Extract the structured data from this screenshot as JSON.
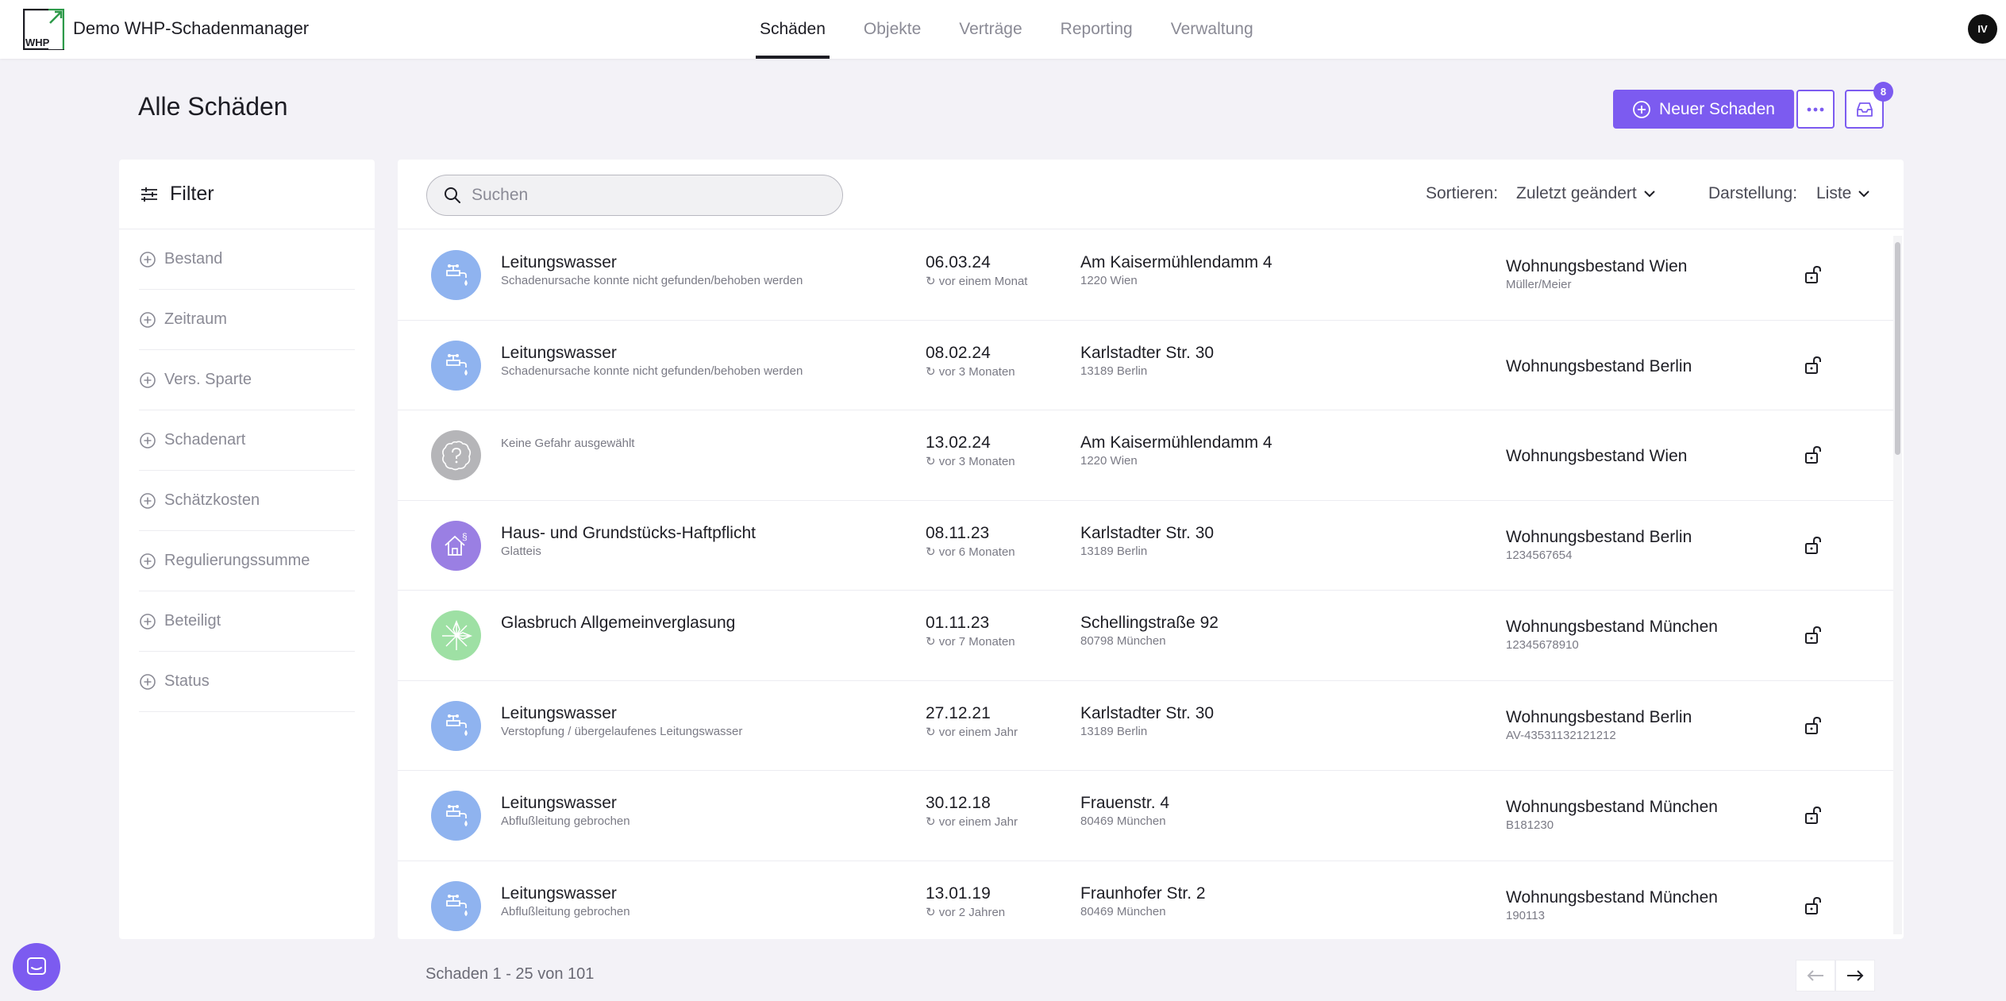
{
  "app": {
    "title": "Demo WHP-Schadenmanager",
    "logo_text": "WHP",
    "user_initials": "IV",
    "accent": "#7c5bf0"
  },
  "nav": [
    {
      "label": "Schäden",
      "active": true
    },
    {
      "label": "Objekte",
      "active": false
    },
    {
      "label": "Verträge",
      "active": false
    },
    {
      "label": "Reporting",
      "active": false
    },
    {
      "label": "Verwaltung",
      "active": false
    }
  ],
  "page": {
    "title": "Alle Schäden",
    "new_button": "Neuer Schaden",
    "inbox_count": "8"
  },
  "filter": {
    "title": "Filter",
    "items": [
      "Bestand",
      "Zeitraum",
      "Vers. Sparte",
      "Schadenart",
      "Schätzkosten",
      "Regulierungssumme",
      "Beteiligt",
      "Status"
    ]
  },
  "toolbar": {
    "search_placeholder": "Suchen",
    "sort_label": "Sortieren:",
    "sort_value": "Zuletzt geändert",
    "view_label": "Darstellung:",
    "view_value": "Liste"
  },
  "rows": [
    {
      "icon": "faucet-icon",
      "icon_color": "#8fb3ef",
      "title": "Leitungswasser",
      "subtitle": "Schadenursache konnte nicht gefunden/behoben werden",
      "date": "06.03.24",
      "relative": "vor einem Monat",
      "address": "Am Kaisermühlendamm 4",
      "city": "1220 Wien",
      "bestand": "Wohnungsbestand Wien",
      "ref": "Müller/Meier"
    },
    {
      "icon": "faucet-icon",
      "icon_color": "#8fb3ef",
      "title": "Leitungswasser",
      "subtitle": "Schadenursache konnte nicht gefunden/behoben werden",
      "date": "08.02.24",
      "relative": "vor 3 Monaten",
      "address": "Karlstadter Str. 30",
      "city": "13189 Berlin",
      "bestand": "Wohnungsbestand Berlin",
      "ref": ""
    },
    {
      "icon": "question-icon",
      "icon_color": "#b5b5b8",
      "title": "",
      "subtitle": "Keine Gefahr ausgewählt",
      "date": "13.02.24",
      "relative": "vor 3 Monaten",
      "address": "Am Kaisermühlendamm 4",
      "city": "1220 Wien",
      "bestand": "Wohnungsbestand Wien",
      "ref": ""
    },
    {
      "icon": "house-liability-icon",
      "icon_color": "#9a7fe3",
      "title": "Haus- und Grundstücks-Haftpflicht",
      "subtitle": "Glatteis",
      "date": "08.11.23",
      "relative": "vor 6 Monaten",
      "address": "Karlstadter Str. 30",
      "city": "13189 Berlin",
      "bestand": "Wohnungsbestand Berlin",
      "ref": "1234567654"
    },
    {
      "icon": "glass-break-icon",
      "icon_color": "#9ee0a4",
      "title": "Glasbruch Allgemeinverglasung",
      "subtitle": "",
      "date": "01.11.23",
      "relative": "vor 7 Monaten",
      "address": "Schellingstraße 92",
      "city": "80798 München",
      "bestand": "Wohnungsbestand München",
      "ref": "12345678910"
    },
    {
      "icon": "faucet-icon",
      "icon_color": "#8fb3ef",
      "title": "Leitungswasser",
      "subtitle": "Verstopfung / übergelaufenes Leitungswasser",
      "date": "27.12.21",
      "relative": "vor einem Jahr",
      "address": "Karlstadter Str. 30",
      "city": "13189 Berlin",
      "bestand": "Wohnungsbestand Berlin",
      "ref": "AV-43531132121212"
    },
    {
      "icon": "faucet-icon",
      "icon_color": "#8fb3ef",
      "title": "Leitungswasser",
      "subtitle": "Abflußleitung gebrochen",
      "date": "30.12.18",
      "relative": "vor einem Jahr",
      "address": "Frauenstr. 4",
      "city": "80469 München",
      "bestand": "Wohnungsbestand München",
      "ref": "B181230"
    },
    {
      "icon": "faucet-icon",
      "icon_color": "#8fb3ef",
      "title": "Leitungswasser",
      "subtitle": "Abflußleitung gebrochen",
      "date": "13.01.19",
      "relative": "vor 2 Jahren",
      "address": "Fraunhofer Str. 2",
      "city": "80469 München",
      "bestand": "Wohnungsbestand München",
      "ref": "190113"
    }
  ],
  "pager": {
    "text": "Schaden 1 - 25 von 101"
  }
}
